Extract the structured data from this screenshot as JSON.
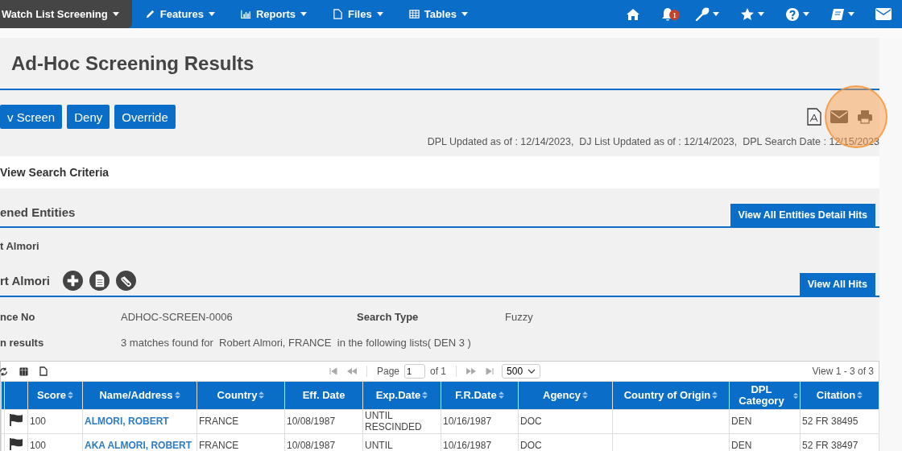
{
  "nav": {
    "menus": [
      {
        "label": "Watch List Screening",
        "selected": true
      },
      {
        "label": "Features",
        "selected": false
      },
      {
        "label": "Reports",
        "selected": false
      },
      {
        "label": "Files",
        "selected": false
      },
      {
        "label": "Tables",
        "selected": false
      }
    ],
    "icons": [
      {
        "dropdown": false
      },
      {
        "dropdown": false,
        "badge": "1"
      },
      {
        "dropdown": true
      },
      {
        "dropdown": true
      },
      {
        "dropdown": true
      },
      {
        "dropdown": true
      },
      {
        "dropdown": false
      }
    ]
  },
  "title": "Ad-Hoc Screening Results",
  "actions": [
    "v Screen",
    "Deny",
    "Override"
  ],
  "list_dates": "DPL Updated as of : 12/14/2023,  DJ List Updated as of : 12/14/2023,  DPL Search Date : 12/15/2023",
  "criteria_panel": "View Search Criteria",
  "entities_section": {
    "title": "ened Entities",
    "button": "View All Entities Detail Hits",
    "entity": "t Almori"
  },
  "entity_section": {
    "title": "rt Almori",
    "button": "View All Hits"
  },
  "info": [
    {
      "label": "nce No",
      "value": "ADHOC-SCREEN-0006",
      "label_2": "Search Type",
      "value_2": "Fuzzy"
    },
    {
      "label": "n results",
      "value": "3 matches found for  Robert Almori, FRANCE  in the following lists( DEN 3 )"
    }
  ],
  "grid": {
    "page_label": "Page",
    "page": "1",
    "page_total": "of 1",
    "page_size": "500",
    "view_count": "View 1 - 3 of 3",
    "columns": [
      {
        "label": "Score",
        "sortable": true,
        "link": false
      },
      {
        "label": "Name/Address",
        "sortable": true,
        "link": true
      },
      {
        "label": "Country",
        "sortable": true,
        "link": false
      },
      {
        "label": "Eff. Date",
        "sortable": false,
        "link": false
      },
      {
        "label": "Exp.Date",
        "sortable": true,
        "link": false
      },
      {
        "label": "F.R.Date",
        "sortable": true,
        "link": false
      },
      {
        "label": "Agency",
        "sortable": true,
        "link": false
      },
      {
        "label": "Country of Origin",
        "sortable": true,
        "link": false
      },
      {
        "label": "DPL Category",
        "sortable": true,
        "link": false
      },
      {
        "label": "Citation",
        "sortable": true,
        "link": false
      }
    ],
    "rows": [
      {
        "cells": [
          "100",
          "ALMORI, ROBERT",
          "FRANCE",
          "10/08/1987",
          "UNTIL RESCINDED",
          "10/16/1987",
          "DOC",
          "",
          "DEN",
          "52 FR 38495"
        ]
      },
      {
        "cells": [
          "100",
          "AKA ALMORI, ROBERT",
          "FRANCE",
          "10/08/1987",
          "UNTIL",
          "10/16/1987",
          "DOC",
          "",
          "DEN",
          "52 FR 38497"
        ]
      }
    ]
  }
}
